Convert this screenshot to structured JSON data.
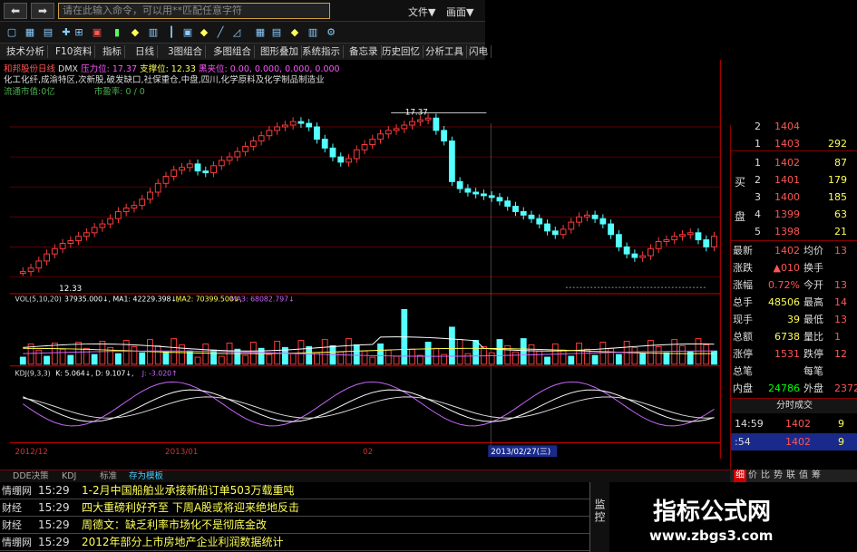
{
  "titlebar": {
    "back": "⬅",
    "forward": "➡",
    "command_placeholder": "请在此输入命令，可以用**匹配任意字符",
    "menu_file": "文件▼",
    "menu_view": "画面▼"
  },
  "tabs": [
    "技术分析",
    "F10资料",
    "指标",
    "日线",
    "3图组合",
    "多图组合",
    "图形叠加",
    "系统指示",
    "备忘录",
    "历史回忆",
    "分析工具",
    "闪电"
  ],
  "info": {
    "stock": "和邦股份日线",
    "indicator": "DMX",
    "label_pressure": "压力位: 17.37",
    "label_support": "支撑位: 12.33",
    "label_break": "黑夹位: 0.00, 0.000, 0.000, 0.000",
    "concepts": "化工化纤,成渝特区,次新股,破发缺口,社保重仓,中盘,四川,化学原料及化学制品制造业",
    "market_value": "流通市值:0亿",
    "volume_label": "市盈率: 0 / 0"
  },
  "chart_labels": {
    "high_price": "17.37",
    "low_price": "12.33",
    "vol_header_1": "VOL(5,10,20)",
    "vol_header_2": "37935.000↓, MA1: 42229.398↓,",
    "vol_header_3": "MA2: 70399.500↓,",
    "vol_header_4": "MA3: 68082.797↓",
    "kdj_header_1": "KDJ(9,3,3)",
    "kdj_header_2": "K: 5.064↓, D: 9.107↓,",
    "kdj_header_3": "J: -3.020↑",
    "date_1": "2012/12",
    "date_2": "2013/01",
    "date_3": "02",
    "date_cursor": "2013/02/27(三)"
  },
  "right_panel": {
    "sell_rows": [
      {
        "idx": "2",
        "price": "1404",
        "vol": ""
      },
      {
        "idx": "1",
        "price": "1403",
        "vol": "292"
      }
    ],
    "buy_label_1": "买",
    "buy_label_2": "盘",
    "buy_rows": [
      {
        "idx": "1",
        "price": "1402",
        "vol": "87"
      },
      {
        "idx": "2",
        "price": "1401",
        "vol": "179"
      },
      {
        "idx": "3",
        "price": "1400",
        "vol": "185"
      },
      {
        "idx": "4",
        "price": "1399",
        "vol": "63"
      },
      {
        "idx": "5",
        "price": "1398",
        "vol": "21"
      }
    ],
    "stats": [
      {
        "k1": "最新",
        "v1": "1402",
        "k2": "均价",
        "v2": "13"
      },
      {
        "k1": "涨跌",
        "v1": "▲010",
        "k2": "换手",
        "v2": ""
      },
      {
        "k1": "涨幅",
        "v1": "0.72%",
        "k2": "今开",
        "v2": "13"
      },
      {
        "k1": "总手",
        "v1": "48506",
        "k2": "最高",
        "v2": "14"
      },
      {
        "k1": "现手",
        "v1": "39",
        "k2": "最低",
        "v2": "13"
      },
      {
        "k1": "总额",
        "v1": "6738",
        "k2": "量比",
        "v2": "1"
      },
      {
        "k1": "涨停",
        "v1": "1531",
        "k2": "跌停",
        "v2": "12"
      },
      {
        "k1": "总笔",
        "v1": "",
        "k2": "每笔",
        "v2": ""
      },
      {
        "k1": "内盘",
        "v1": "24786",
        "k2": "外盘",
        "v2": "2372"
      }
    ],
    "ticks_title": "分时成交",
    "ticks": [
      {
        "time": "14:59",
        "price": "1402",
        "vol": "9"
      },
      {
        "time": ":54",
        "price": "1402",
        "vol": "9"
      }
    ],
    "side_tabs": [
      "细",
      "价",
      "比",
      "势",
      "联",
      "值",
      "筹"
    ]
  },
  "bottom_tabs": [
    "DDE决策",
    "KDJ",
    "标准",
    "存为模板"
  ],
  "news": [
    {
      "src": "情绷网",
      "time": "15:29",
      "text": "1-2月中国船舶业承接新船订单503万载重吨"
    },
    {
      "src": "财经",
      "time": "15:29",
      "text": "四大重磅利好齐至 下周A股或将迎来绝地反击"
    },
    {
      "src": "财经",
      "time": "15:29",
      "text": "周德文：缺乏利率市场化不是彻底金改"
    },
    {
      "src": "情绷网",
      "time": "15:29",
      "text": "2012年部分上市房地产企业利润数据统计"
    }
  ],
  "monitor_label": "监控",
  "watermark": {
    "title": "指标公式网",
    "url": "www.zbgs3.com"
  },
  "colors": {
    "up": "#ff3c3c",
    "down": "#54ffff",
    "ma_white": "#ffffff",
    "ma_yellow": "#ffff55",
    "ma_purple": "#cc66ff",
    "grid": "#800000"
  }
}
